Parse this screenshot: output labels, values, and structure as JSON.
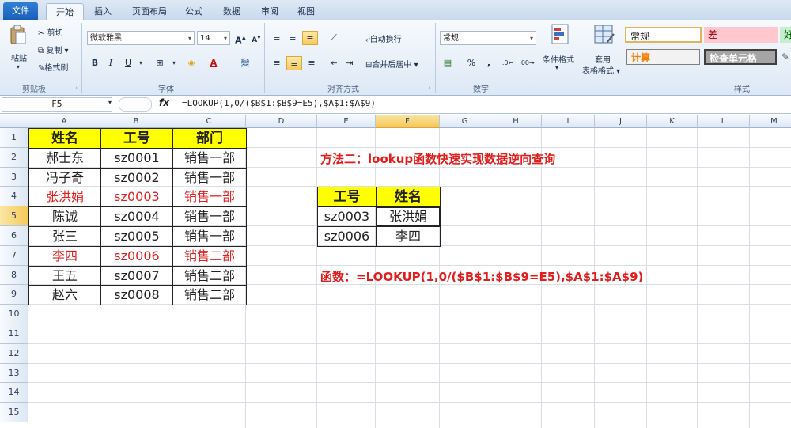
{
  "ribbon": {
    "tabs": [
      "文件",
      "开始",
      "插入",
      "页面布局",
      "公式",
      "数据",
      "审阅",
      "视图"
    ],
    "clipboard": {
      "paste": "粘贴",
      "cut": "剪切",
      "copy": "复制",
      "format_painter": "格式刷",
      "label": "剪贴板"
    },
    "font": {
      "name": "微软雅黑",
      "size": "14",
      "bold": "B",
      "italic": "I",
      "underline": "U",
      "label": "字体"
    },
    "alignment": {
      "wrap": "自动换行",
      "merge": "合并后居中",
      "label": "对齐方式"
    },
    "number": {
      "format": "常规",
      "percent": "%",
      "comma": ",",
      "label": "数字"
    },
    "styles": {
      "cond_format": "条件格式",
      "table_format_1": "套用",
      "table_format_2": "表格格式",
      "normal": "常规",
      "bad": "差",
      "good": "好",
      "calc": "计算",
      "check": "检查单元格",
      "label": "样式"
    }
  },
  "formula_bar": {
    "name_box": "F5",
    "fx": "fx",
    "formula": "=LOOKUP(1,0/($B$1:$B$9=E5),$A$1:$A$9)"
  },
  "columns": [
    "A",
    "B",
    "C",
    "D",
    "E",
    "F",
    "G",
    "H",
    "I",
    "J",
    "K",
    "L",
    "M"
  ],
  "rows": [
    "1",
    "2",
    "3",
    "4",
    "5",
    "6",
    "7",
    "8",
    "9",
    "10",
    "11",
    "12",
    "13",
    "14",
    "15"
  ],
  "table": {
    "headers": [
      "姓名",
      "工号",
      "部门"
    ],
    "rows": [
      [
        "郝士东",
        "sz0001",
        "销售一部"
      ],
      [
        "冯子奇",
        "sz0002",
        "销售一部"
      ],
      [
        "张洪娟",
        "sz0003",
        "销售一部"
      ],
      [
        "陈诚",
        "sz0004",
        "销售一部"
      ],
      [
        "张三",
        "sz0005",
        "销售一部"
      ],
      [
        "李四",
        "sz0006",
        "销售二部"
      ],
      [
        "王五",
        "sz0007",
        "销售二部"
      ],
      [
        "赵六",
        "sz0008",
        "销售二部"
      ]
    ]
  },
  "lookup": {
    "headers": [
      "工号",
      "姓名"
    ],
    "rows": [
      [
        "sz0003",
        "张洪娟"
      ],
      [
        "sz0006",
        "李四"
      ]
    ]
  },
  "notes": {
    "method": "方法二：lookup函数快速实现数据逆向查询",
    "function": "函数：=LOOKUP(1,0/($B$1:$B$9=E5),$A$1:$A$9)"
  },
  "colors": {
    "header_fill": "#ffff00",
    "highlight_text": "#e02020",
    "selection": "#f5c95b"
  }
}
